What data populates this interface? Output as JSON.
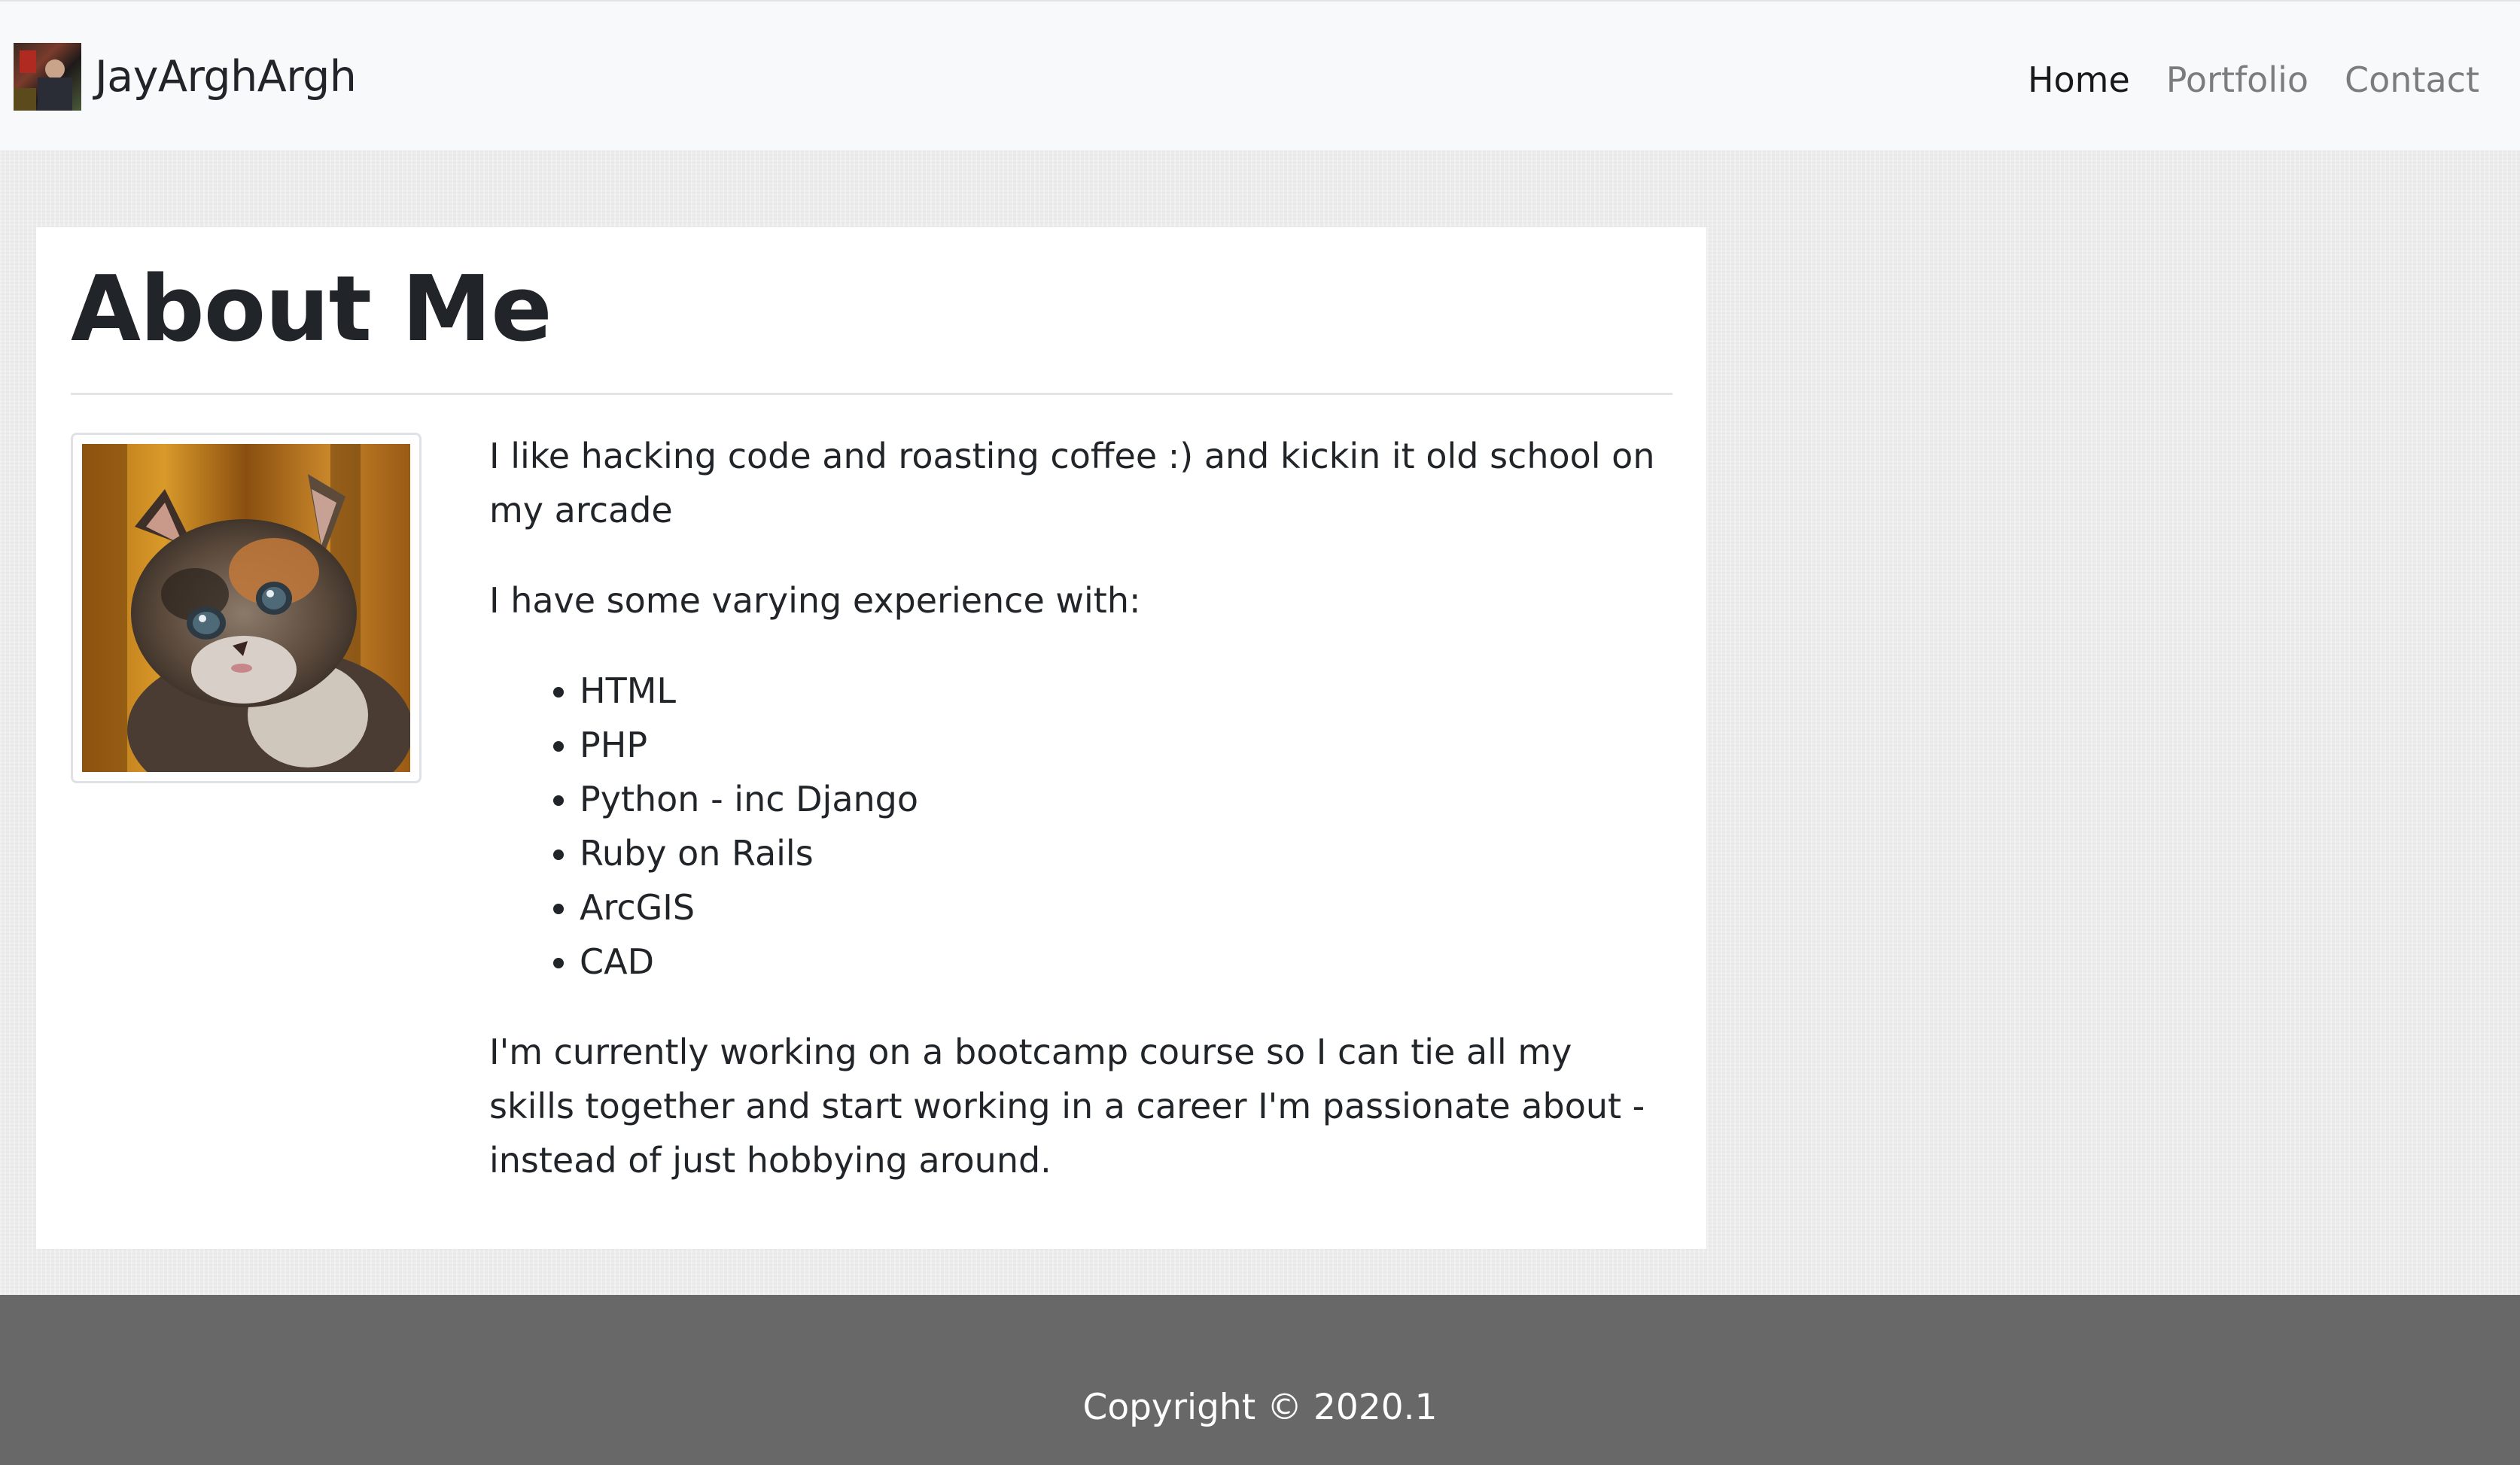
{
  "navbar": {
    "brand_text": "JayArghArgh",
    "links": [
      {
        "label": "Home",
        "active": true
      },
      {
        "label": "Portfolio",
        "active": false
      },
      {
        "label": "Contact",
        "active": false
      }
    ]
  },
  "main": {
    "title": "About Me",
    "photo_subject": "kitten",
    "paragraph_1": "I like hacking code and roasting coffee :) and kickin it old school on my arcade",
    "paragraph_2": "I have some varying experience with:",
    "skills": [
      "HTML",
      "PHP",
      "Python - inc Django",
      "Ruby on Rails",
      "ArcGIS",
      "CAD"
    ],
    "paragraph_3": "I'm currently working on a bootcamp course so I can tie all my skills together and start working in a career I'm passionate about - instead of just hobbying around."
  },
  "footer": {
    "copyright": "Copyright © 2020.1"
  }
}
